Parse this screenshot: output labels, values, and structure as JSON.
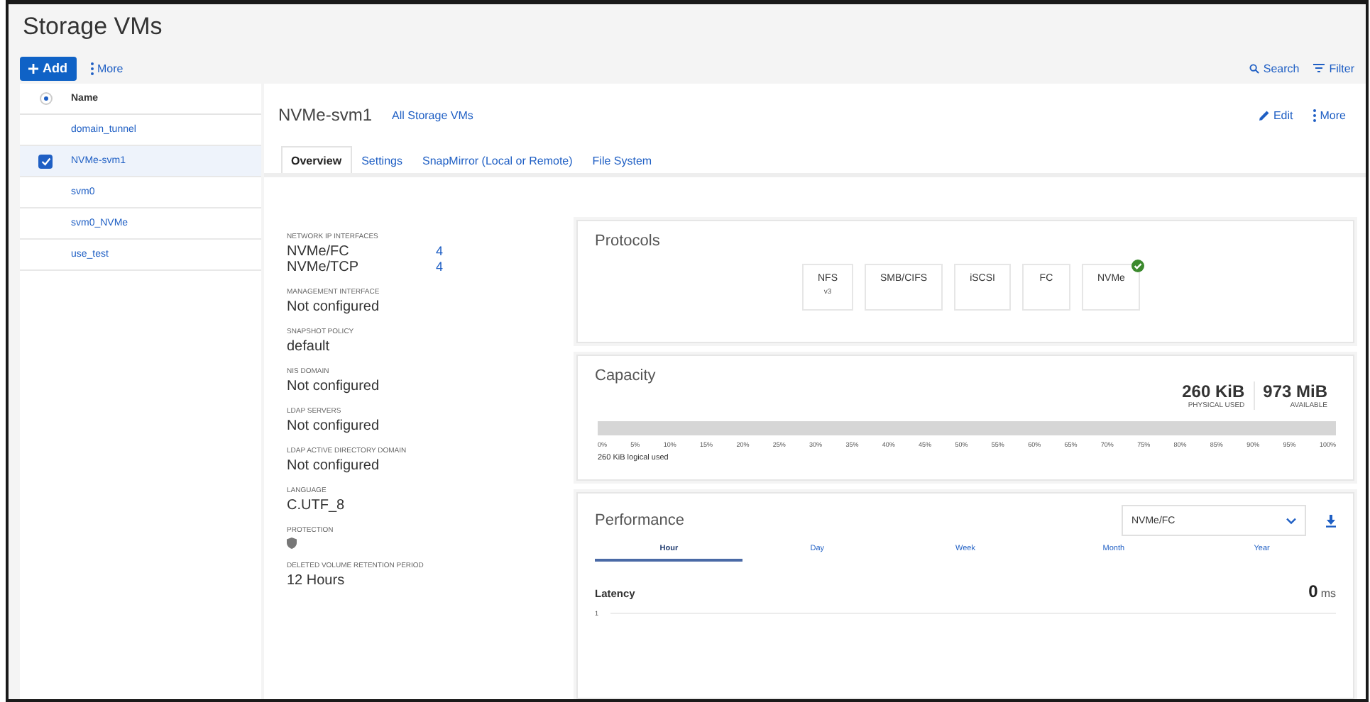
{
  "page": {
    "title": "Storage VMs"
  },
  "toolbar": {
    "add": "Add",
    "more": "More",
    "search": "Search",
    "filter": "Filter"
  },
  "list": {
    "header": "Name",
    "header_selected": true,
    "rows": [
      {
        "name": "domain_tunnel",
        "selected": false
      },
      {
        "name": "NVMe-svm1",
        "selected": true
      },
      {
        "name": "svm0",
        "selected": false
      },
      {
        "name": "svm0_NVMe",
        "selected": false
      },
      {
        "name": "use_test",
        "selected": false
      }
    ]
  },
  "detail": {
    "title": "NVMe-svm1",
    "back_link": "All Storage VMs",
    "edit": "Edit",
    "more": "More",
    "tabs": [
      {
        "label": "Overview",
        "selected": true
      },
      {
        "label": "Settings",
        "selected": false
      },
      {
        "label": "SnapMirror (Local or Remote)",
        "selected": false
      },
      {
        "label": "File System",
        "selected": false
      }
    ]
  },
  "overview": {
    "network_label": "NETWORK IP INTERFACES",
    "interfaces": [
      {
        "name": "NVMe/FC",
        "count": "4"
      },
      {
        "name": "NVMe/TCP",
        "count": "4"
      }
    ],
    "fields": [
      {
        "label": "MANAGEMENT INTERFACE",
        "value": "Not configured",
        "kind": "text"
      },
      {
        "label": "SNAPSHOT POLICY",
        "value": "default",
        "kind": "text"
      },
      {
        "label": "NIS DOMAIN",
        "value": "Not configured",
        "kind": "text"
      },
      {
        "label": "LDAP SERVERS",
        "value": "Not configured",
        "kind": "text"
      },
      {
        "label": "LDAP ACTIVE DIRECTORY DOMAIN",
        "value": "Not configured",
        "kind": "text"
      },
      {
        "label": "LANGUAGE",
        "value": "C.UTF_8",
        "kind": "text"
      },
      {
        "label": "PROTECTION",
        "kind": "shield"
      },
      {
        "label": "DELETED VOLUME RETENTION PERIOD",
        "value": "12 Hours",
        "kind": "text"
      }
    ]
  },
  "protocols": {
    "title": "Protocols",
    "items": [
      {
        "name": "NFS",
        "version": "v3",
        "enabled": false
      },
      {
        "name": "SMB/CIFS",
        "enabled": false
      },
      {
        "name": "iSCSI",
        "enabled": false
      },
      {
        "name": "FC",
        "enabled": false
      },
      {
        "name": "NVMe",
        "enabled": true
      }
    ]
  },
  "capacity": {
    "title": "Capacity",
    "used": "260 KiB",
    "used_label": "PHYSICAL USED",
    "available": "973 MiB",
    "available_label": "AVAILABLE",
    "level": 0,
    "ticks": [
      "0%",
      "5%",
      "10%",
      "15%",
      "20%",
      "25%",
      "30%",
      "35%",
      "40%",
      "45%",
      "50%",
      "55%",
      "60%",
      "65%",
      "70%",
      "75%",
      "80%",
      "85%",
      "90%",
      "95%",
      "100%"
    ],
    "logical": "260 KiB logical used"
  },
  "performance": {
    "title": "Performance",
    "dropdown": "NVMe/FC",
    "periods": [
      {
        "label": "Hour",
        "selected": true
      },
      {
        "label": "Day",
        "selected": false
      },
      {
        "label": "Week",
        "selected": false
      },
      {
        "label": "Month",
        "selected": false
      },
      {
        "label": "Year",
        "selected": false
      }
    ],
    "metric": "Latency",
    "value": "0",
    "unit": "ms",
    "axis_label": "1"
  }
}
